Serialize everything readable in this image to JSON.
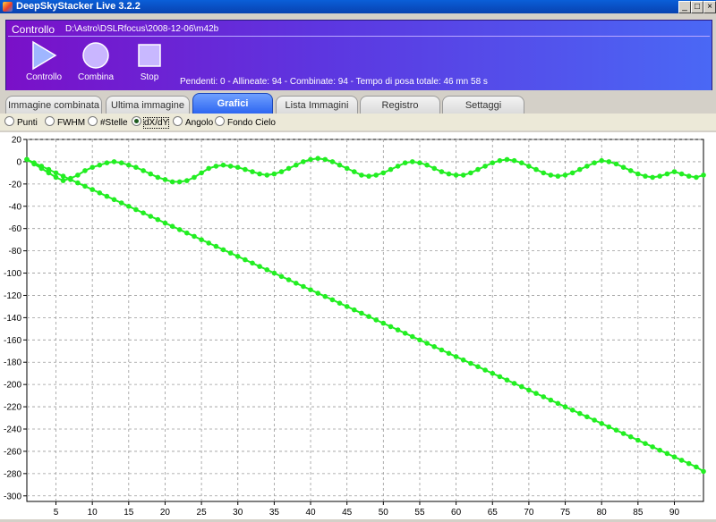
{
  "window": {
    "title": "DeepSkyStacker Live 3.2.2"
  },
  "control": {
    "title": "Controllo",
    "path": "D:\\Astro\\DSLRfocus\\2008-12-06\\m42b",
    "buttons": [
      {
        "label": "Controllo",
        "icon": "play-icon"
      },
      {
        "label": "Combina",
        "icon": "circle-icon"
      },
      {
        "label": "Stop",
        "icon": "stop-icon"
      }
    ],
    "status": "Pendenti: 0 - Allineate: 94 - Combinate: 94 - Tempo di posa totale: 46 mn 58 s"
  },
  "tabs": [
    {
      "label": "Immagine combinata",
      "active": false
    },
    {
      "label": "Ultima immagine",
      "active": false
    },
    {
      "label": "Grafici",
      "active": true
    },
    {
      "label": "Lista Immagini",
      "active": false
    },
    {
      "label": "Registro",
      "active": false
    },
    {
      "label": "Settaggi",
      "active": false
    }
  ],
  "radios": [
    {
      "label": "Punti",
      "checked": false
    },
    {
      "label": "FWHM",
      "checked": false
    },
    {
      "label": "#Stelle",
      "checked": false
    },
    {
      "label": "dX/dY",
      "checked": true
    },
    {
      "label": "Angolo",
      "checked": false
    },
    {
      "label": "Fondo Cielo",
      "checked": false
    }
  ],
  "colors": {
    "series": "#22ee22",
    "accent": "#2a63f0",
    "panel": "#6a2ad8"
  },
  "chart_data": {
    "type": "scatter",
    "xlim": [
      1,
      94
    ],
    "ylim": [
      -305,
      20
    ],
    "x_ticks": [
      5,
      10,
      15,
      20,
      25,
      30,
      35,
      40,
      45,
      50,
      55,
      60,
      65,
      70,
      75,
      80,
      85,
      90
    ],
    "y_ticks": [
      20,
      0,
      -20,
      -40,
      -60,
      -80,
      -100,
      -120,
      -140,
      -160,
      -180,
      -200,
      -220,
      -240,
      -260,
      -280,
      -300
    ],
    "grid": true,
    "series": [
      {
        "x_start": 1,
        "x_end": 94,
        "y_start": 2,
        "y_end": -278,
        "values": [
          2,
          -1,
          -4,
          -7,
          -10,
          -13,
          -16,
          -19,
          -22,
          -25,
          -28,
          -31,
          -34,
          -37,
          -40,
          -43,
          -46,
          -49,
          -52,
          -55,
          -58,
          -61,
          -64,
          -67,
          -70,
          -73,
          -76,
          -79,
          -82,
          -85,
          -88,
          -91,
          -94,
          -97,
          -100,
          -103,
          -106,
          -109,
          -112,
          -115,
          -118,
          -121,
          -124,
          -127,
          -130,
          -133,
          -136,
          -139,
          -142,
          -145,
          -148,
          -151,
          -154,
          -157,
          -160,
          -163,
          -166,
          -169,
          -172,
          -175,
          -178,
          -181,
          -184,
          -187,
          -190,
          -193,
          -196,
          -199,
          -202,
          -205,
          -208,
          -211,
          -214,
          -217,
          -220,
          -223,
          -226,
          -229,
          -232,
          -235,
          -238,
          -241,
          -244,
          -247,
          -250,
          -253,
          -256,
          -259,
          -262,
          -265,
          -268,
          -271,
          -274,
          -278
        ]
      },
      {
        "x_start": 1,
        "x_end": 94,
        "values": [
          2,
          -2,
          -6,
          -10,
          -14,
          -17,
          -15,
          -12,
          -8,
          -5,
          -3,
          -1,
          0,
          -1,
          -3,
          -5,
          -8,
          -11,
          -14,
          -16,
          -18,
          -18,
          -17,
          -14,
          -10,
          -6,
          -4,
          -3,
          -4,
          -5,
          -7,
          -9,
          -11,
          -12,
          -11,
          -9,
          -6,
          -3,
          0,
          2,
          3,
          2,
          0,
          -3,
          -6,
          -9,
          -12,
          -13,
          -12,
          -10,
          -7,
          -4,
          -1,
          0,
          -1,
          -3,
          -6,
          -9,
          -11,
          -12,
          -12,
          -10,
          -7,
          -4,
          -1,
          1,
          2,
          1,
          -1,
          -4,
          -7,
          -10,
          -12,
          -13,
          -12,
          -10,
          -7,
          -4,
          -1,
          1,
          0,
          -2,
          -5,
          -8,
          -11,
          -13,
          -14,
          -13,
          -11,
          -9,
          -11,
          -13,
          -14,
          -12
        ]
      }
    ]
  }
}
